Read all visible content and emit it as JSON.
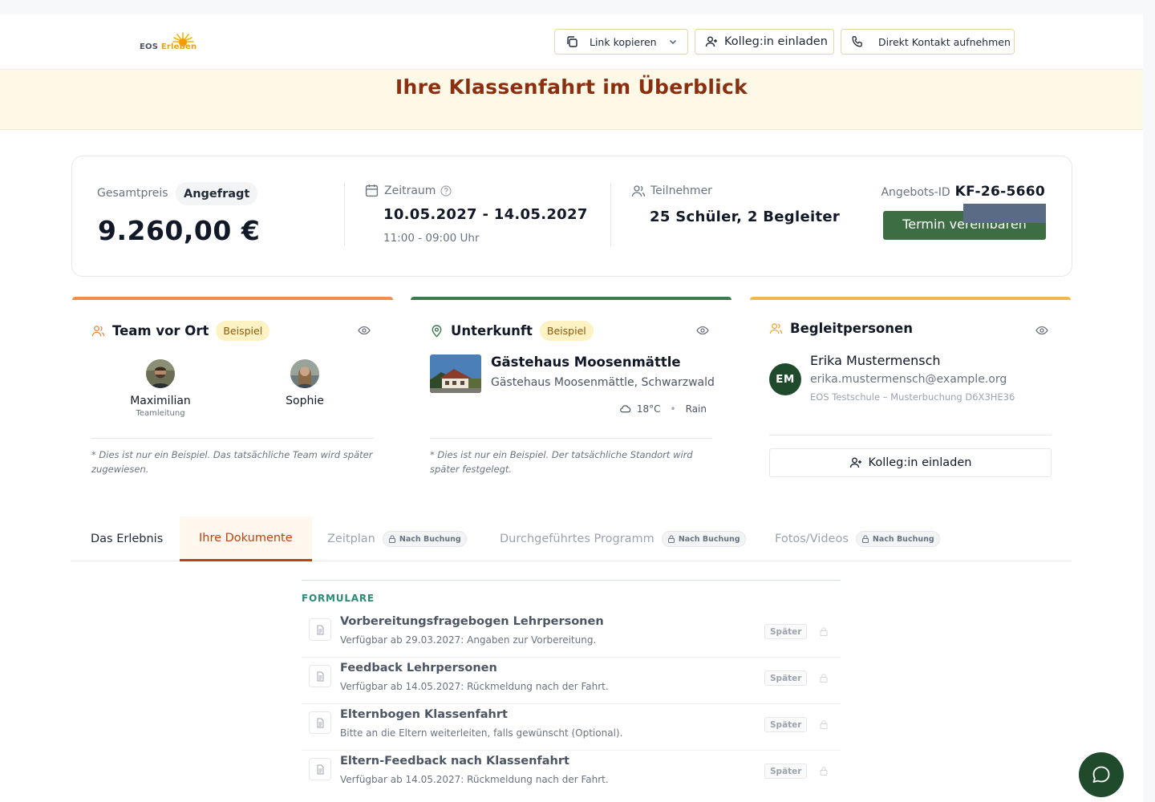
{
  "header": {
    "logo_text_a": "EOS",
    "logo_text_b": "Erleben",
    "copy_link_label": "Link kopieren",
    "invite_label": "Kolleg:in einladen",
    "contact_label": "Direkt Kontakt aufnehmen"
  },
  "banner": {
    "title": "Ihre Klassenfahrt im Überblick"
  },
  "summary": {
    "price_label": "Gesamtpreis",
    "status": "Angefragt",
    "price": "9.260,00 €",
    "period_label": "Zeitraum",
    "dates": "10.05.2027 - 14.05.2027",
    "hours": "11:00 - 09:00 Uhr",
    "participants_label": "Teilnehmer",
    "participants": "25 Schüler,  2 Begleiter",
    "offer_label": "Angebots-ID",
    "offer_id": "KF-26-5660",
    "appointment_button": "Termin vereinbaren"
  },
  "team_card": {
    "title": "Team vor Ort",
    "badge": "Beispiel",
    "members": [
      {
        "name": "Maximilian",
        "role": "Teamleitung"
      },
      {
        "name": "Sophie",
        "role": ""
      }
    ],
    "note": "* Dies ist nur ein Beispiel. Das tatsächliche Team wird später zugewiesen.",
    "accent": "#f28c4a"
  },
  "accommodation_card": {
    "title": "Unterkunft",
    "badge": "Beispiel",
    "name": "Gästehaus Moosenmättle",
    "address": "Gästehaus Moosenmättle, Schwarzwald",
    "temperature": "18°C",
    "weather": "Rain",
    "note": "* Dies ist nur ein Beispiel. Der tatsächliche Standort wird später festgelegt.",
    "accent": "#3f7a4e"
  },
  "companions_card": {
    "title": "Begleitpersonen",
    "initials": "EM",
    "name": "Erika Mustermensch",
    "email": "erika.mustermensch@example.org",
    "school": "EOS Testschule – Musterbuchung D6X3HE36",
    "invite_label": "Kolleg:in einladen",
    "accent": "#f0b84e"
  },
  "tabs": [
    {
      "label": "Das Erlebnis",
      "state": "normal"
    },
    {
      "label": "Ihre Dokumente",
      "state": "active"
    },
    {
      "label": "Zeitplan",
      "state": "locked",
      "lock_label": "Nach Buchung"
    },
    {
      "label": "Durchgeführtes Programm",
      "state": "locked",
      "lock_label": "Nach Buchung"
    },
    {
      "label": "Fotos/Videos",
      "state": "locked",
      "lock_label": "Nach Buchung"
    }
  ],
  "forms": {
    "heading": "FORMULARE",
    "items": [
      {
        "title": "Vorbereitungsfragebogen Lehrpersonen",
        "subtitle": "Verfügbar ab 29.03.2027: Angaben zur Vorbereitung.",
        "status": "Später"
      },
      {
        "title": "Feedback Lehrpersonen",
        "subtitle": "Verfügbar ab 14.05.2027: Rückmeldung nach der Fahrt.",
        "status": "Später"
      },
      {
        "title": "Elternbogen Klassenfahrt",
        "subtitle": "Bitte an die Eltern weiterleiten, falls gewünscht (Optional).",
        "status": "Später"
      },
      {
        "title": "Eltern-Feedback nach Klassenfahrt",
        "subtitle": "Verfügbar ab 14.05.2027: Rückmeldung nach der Fahrt.",
        "status": "Später"
      }
    ]
  },
  "colors": {
    "brand_green": "#3d6e43",
    "banner_title": "#8a2f10",
    "active_tab": "#c2410c",
    "forms_heading": "#2c8a78"
  },
  "icons": [
    "copy-icon",
    "chevron-down-icon",
    "user-plus-icon",
    "phone-icon",
    "calendar-icon",
    "help-icon",
    "users-icon",
    "eye-icon",
    "map-pin-icon",
    "cloud-icon",
    "lock-icon",
    "document-icon",
    "chat-icon"
  ]
}
